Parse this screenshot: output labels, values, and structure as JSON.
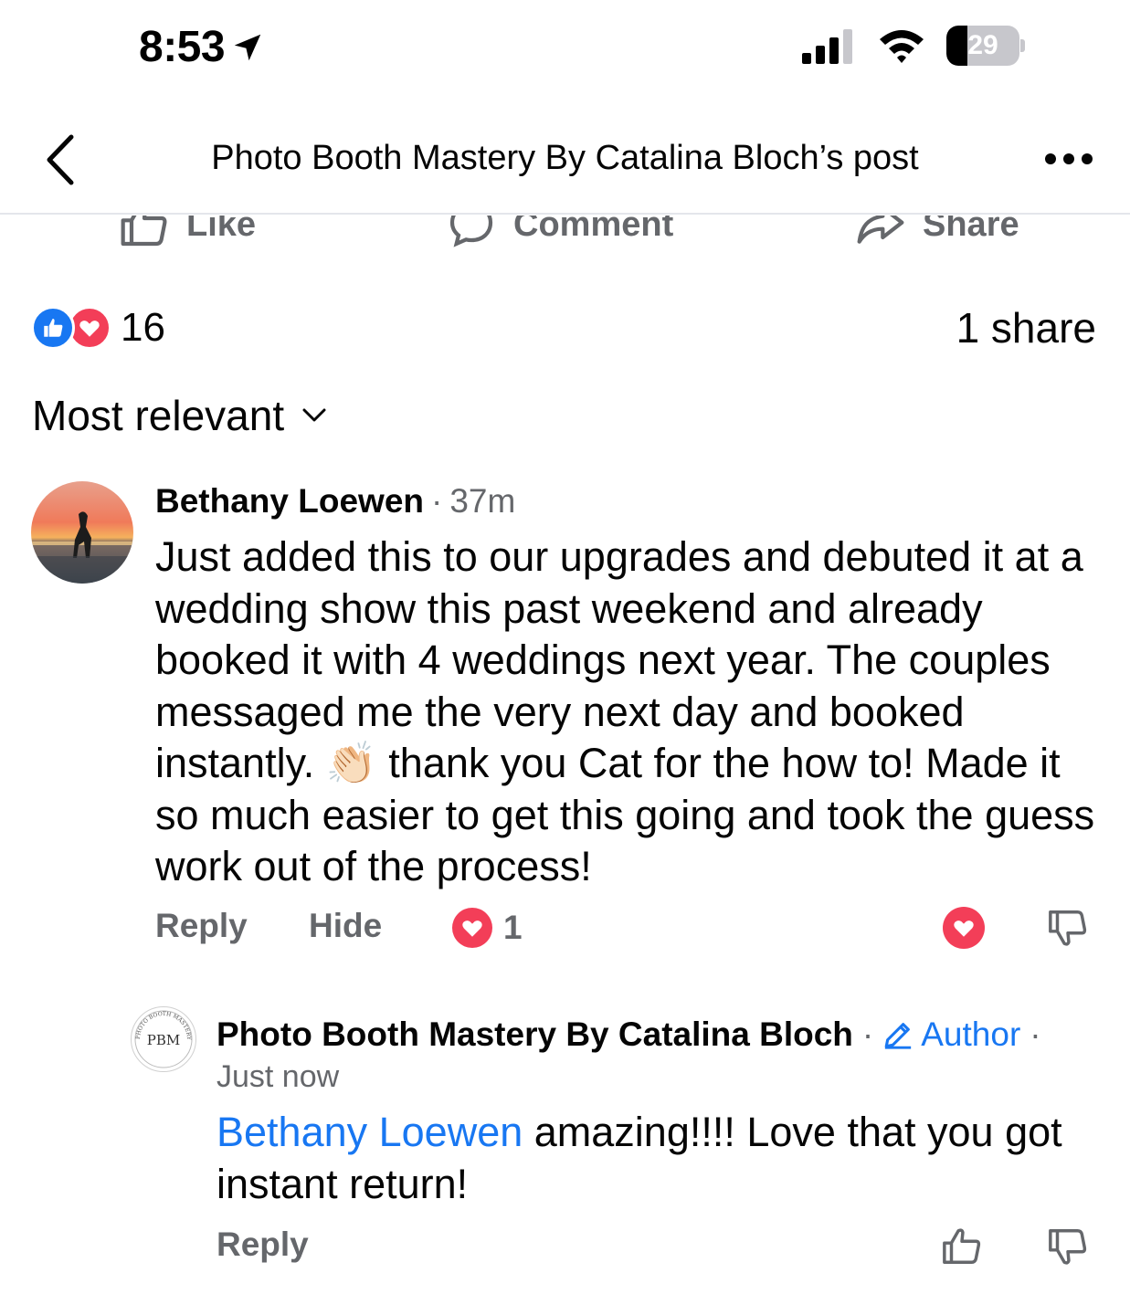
{
  "status_bar": {
    "time": "8:53",
    "battery": "29",
    "battery_level": 0.29,
    "icons": [
      "location-arrow-icon",
      "signal-icon",
      "wifi-icon",
      "battery-icon"
    ]
  },
  "header": {
    "title": "Photo Booth Mastery By Catalina Bloch’s post"
  },
  "post_actions": {
    "like": "Like",
    "comment": "Comment",
    "share": "Share"
  },
  "reactions": {
    "count": "16",
    "shares": "1 share"
  },
  "sort": {
    "label": "Most relevant"
  },
  "comments": [
    {
      "author": "Bethany Loewen",
      "time": "37m",
      "text_part1": "Just added this to our upgrades and debuted it at a wedding show this past weekend and already booked it with 4 weddings next year. The couples messaged me the very next day and booked instantly. ",
      "emoji": "👏🏻",
      "text_part2": " thank you Cat for the how to! Made it so much easier to get this going and took the guess work out of the process!",
      "reply_label": "Reply",
      "hide_label": "Hide",
      "love_count": "1"
    }
  ],
  "reply": {
    "author": "Photo Booth Mastery By Catalina Bloch",
    "author_badge": "Author",
    "time": "Just now",
    "mention": "Bethany Loewen",
    "text": " amazing!!!! Love that you got instant return!",
    "reply_label": "Reply",
    "avatar_text": "PBM",
    "avatar_ring_text": "PHOTO BOOTH MASTERY"
  },
  "colors": {
    "accent": "#1877f2",
    "love": "#f33e58",
    "secondary_text": "#65676b",
    "primary_text": "#050505"
  }
}
